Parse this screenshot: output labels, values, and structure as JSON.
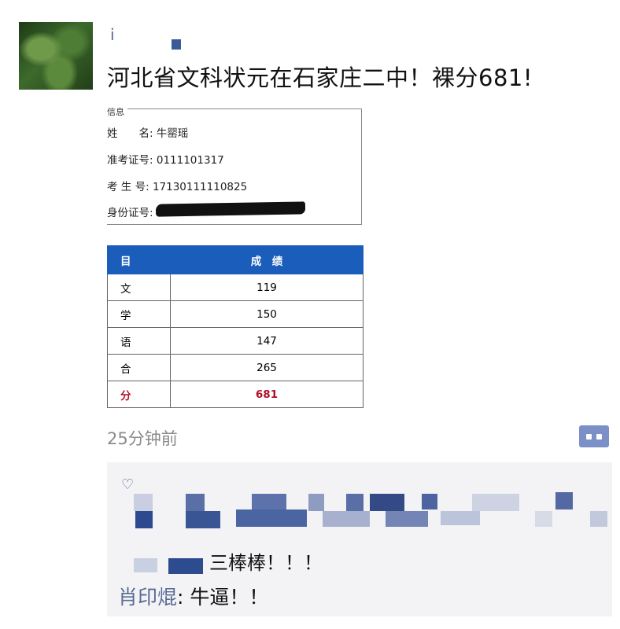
{
  "post": {
    "username": "i",
    "text": "河北省文科状元在石家庄二中！裸分681!",
    "time": "25分钟前"
  },
  "card": {
    "title": "信息",
    "name_label": "姓　　名:",
    "name_value": "牛罂瑶",
    "exam_id_label": "准考证号:",
    "exam_id_value": "0111101317",
    "student_no_label": "考 生 号:",
    "student_no_value": "17130111110825",
    "id_label": "身份证号:"
  },
  "scores": {
    "headers": [
      "目",
      "成　绩"
    ],
    "rows": [
      {
        "subject": "文",
        "score": "119"
      },
      {
        "subject": "学",
        "score": "150"
      },
      {
        "subject": "语",
        "score": "147"
      },
      {
        "subject": "合",
        "score": "265"
      },
      {
        "subject": "分",
        "score": "681"
      }
    ]
  },
  "comments": {
    "comment1_text": "三棒棒！！！",
    "comment2_author": "肖印焜",
    "comment2_text": ": 牛逼！！"
  },
  "colors": {
    "link_blue": "#576b95",
    "header_blue": "#1a5dbb",
    "total_red": "#b0102a",
    "comment_bg": "#f3f3f5"
  },
  "icons": [
    "avatar",
    "more-icon",
    "heart-icon"
  ]
}
